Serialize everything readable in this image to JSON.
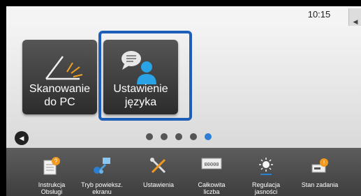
{
  "status": {
    "time": "10:15"
  },
  "tiles": [
    {
      "label": "Skanowanie\ndo PC",
      "icon": "scanner-icon"
    },
    {
      "label": "Ustawienie\njęzyka",
      "icon": "language-icon",
      "selected": true
    }
  ],
  "pagination": {
    "count": 5,
    "active_index": 4
  },
  "bottom_bar": [
    {
      "label": "Instrukcja\nObsługi",
      "icon": "manual-icon"
    },
    {
      "label": "Tryb powieksz.\nekranu",
      "icon": "zoom-mode-icon"
    },
    {
      "label": "Ustawienia",
      "icon": "settings-icon"
    },
    {
      "label": "Całkowita\nliczba",
      "icon": "counter-icon",
      "counter_text": "00000"
    },
    {
      "label": "Regulacja\njasności",
      "icon": "brightness-icon"
    },
    {
      "label": "Stan zadania",
      "icon": "job-status-icon"
    }
  ],
  "colors": {
    "accent": "#1d5fb8",
    "active_dot": "#2e7ed6",
    "tile": "#3a3a3a",
    "bar": "#4d4d4d"
  }
}
